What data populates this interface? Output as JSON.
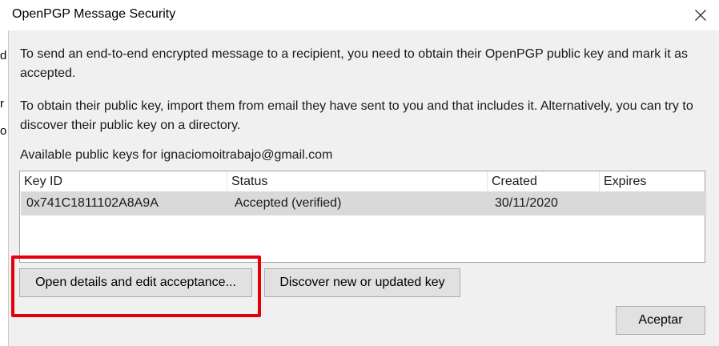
{
  "window": {
    "title": "OpenPGP Message Security",
    "close_icon": "close-icon",
    "left_edge_chars": [
      "d",
      "r",
      "o"
    ]
  },
  "intro": {
    "paragraph1": "To send an end-to-end encrypted message to a recipient, you need to obtain their OpenPGP public key and mark it as accepted.",
    "paragraph2": "To obtain their public key, import them from email they have sent to you and that includes it. Alternatively, you can try to discover their public key on a directory."
  },
  "keys": {
    "label": "Available public keys for ignaciomoitrabajo@gmail.com",
    "columns": [
      "Key ID",
      "Status",
      "Created",
      "Expires"
    ],
    "rows": [
      {
        "key_id": "0x741C1811102A8A9A",
        "status": "Accepted (verified)",
        "created": "30/11/2020",
        "expires": ""
      }
    ]
  },
  "buttons": {
    "open_details": "Open details and edit acceptance...",
    "discover": "Discover new or updated key",
    "accept": "Aceptar"
  },
  "colors": {
    "highlight": "#e3000b",
    "selected_row": "#d9d9d9",
    "dialog_bg": "#f0f0f0"
  }
}
